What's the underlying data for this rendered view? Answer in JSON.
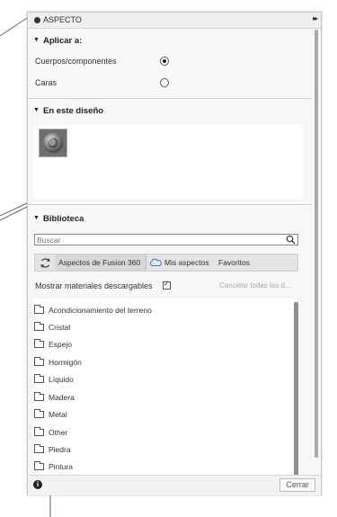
{
  "panel": {
    "title": "ASPECTO"
  },
  "apply_section": {
    "header": "Aplicar a:",
    "options": [
      {
        "label": "Cuerpos/componentes",
        "selected": true
      },
      {
        "label": "Caras",
        "selected": false
      }
    ]
  },
  "design_section": {
    "header": "En este diseño"
  },
  "library_section": {
    "header": "Biblioteca",
    "search_placeholder": "Buscar",
    "tabs": [
      {
        "label": "Aspectos de Fusion 360",
        "active": true
      },
      {
        "label": "Mis aspectos",
        "active": false
      },
      {
        "label": "Favoritos",
        "active": false
      }
    ],
    "show_downloadable_label": "Mostrar materiales descargables",
    "show_downloadable_checked": true,
    "cancel_all_label": "Cancelar todas las d...",
    "folders": [
      "Acondicionamiento del terreno",
      "Cristal",
      "Espejo",
      "Hormigón",
      "Líquido",
      "Madera",
      "Metal",
      "Other",
      "Piedra",
      "Pintura"
    ]
  },
  "footer": {
    "info_icon": "info-icon",
    "close_label": "Cerrar"
  }
}
